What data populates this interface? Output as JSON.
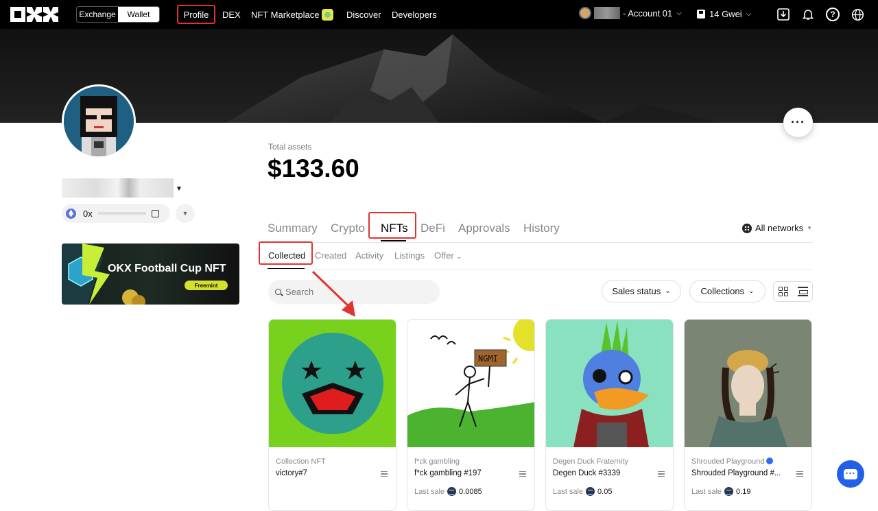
{
  "topbar": {
    "mode_switch": {
      "exchange": "Exchange",
      "wallet": "Wallet"
    },
    "nav": [
      "Profile",
      "DEX",
      "NFT Marketplace",
      "Discover",
      "Developers"
    ],
    "account_label": "- Account 01",
    "gas_label": "14 Gwei"
  },
  "profile": {
    "address_prefix": "0x"
  },
  "banner": {
    "title": "OKX Football Cup NFT",
    "pill": "Freemint"
  },
  "assets": {
    "label": "Total assets",
    "value": "$133.60"
  },
  "tabs": {
    "items": [
      "Summary",
      "Crypto",
      "NFTs",
      "DeFi",
      "Approvals",
      "History"
    ],
    "active": "NFTs",
    "networks_label": "All networks"
  },
  "subtabs": {
    "items": [
      "Collected",
      "Created",
      "Activity",
      "Listings",
      "Offer"
    ],
    "active": "Collected"
  },
  "filters": {
    "search_placeholder": "Search",
    "sales_status": "Sales status",
    "collections": "Collections"
  },
  "cards": [
    {
      "collection": "Collection NFT",
      "name": "victory#7",
      "sale_label": "",
      "sale_value": ""
    },
    {
      "collection": "f*ck gambling",
      "name": "f*ck gambling #197",
      "sale_label": "Last sale",
      "sale_value": "0.0085"
    },
    {
      "collection": "Degen Duck Fraternity",
      "name": "Degen Duck #3339",
      "sale_label": "Last sale",
      "sale_value": "0.05"
    },
    {
      "collection": "Shrouded Playground",
      "name": "Shrouded Playground #...",
      "sale_label": "Last sale",
      "sale_value": "0.19"
    }
  ],
  "card_art": {
    "ngmi_sign": "NGMI"
  },
  "colors": {
    "accent_red": "#e0342f",
    "chat_blue": "#2260e8"
  }
}
